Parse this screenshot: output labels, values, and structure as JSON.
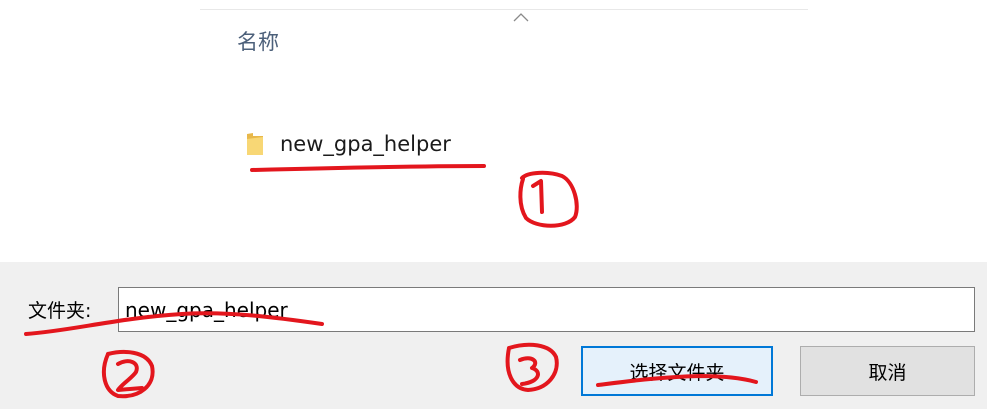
{
  "file_list": {
    "column_header": "名称",
    "items": [
      {
        "name": "new_gpa_helper",
        "icon": "folder-icon"
      }
    ]
  },
  "dialog": {
    "folder_label": "文件夹:",
    "folder_value": "new_gpa_helper",
    "select_button": "选择文件夹",
    "cancel_button": "取消"
  },
  "annotations": {
    "color": "#e3161d",
    "markers": [
      "1",
      "2",
      "3"
    ]
  }
}
